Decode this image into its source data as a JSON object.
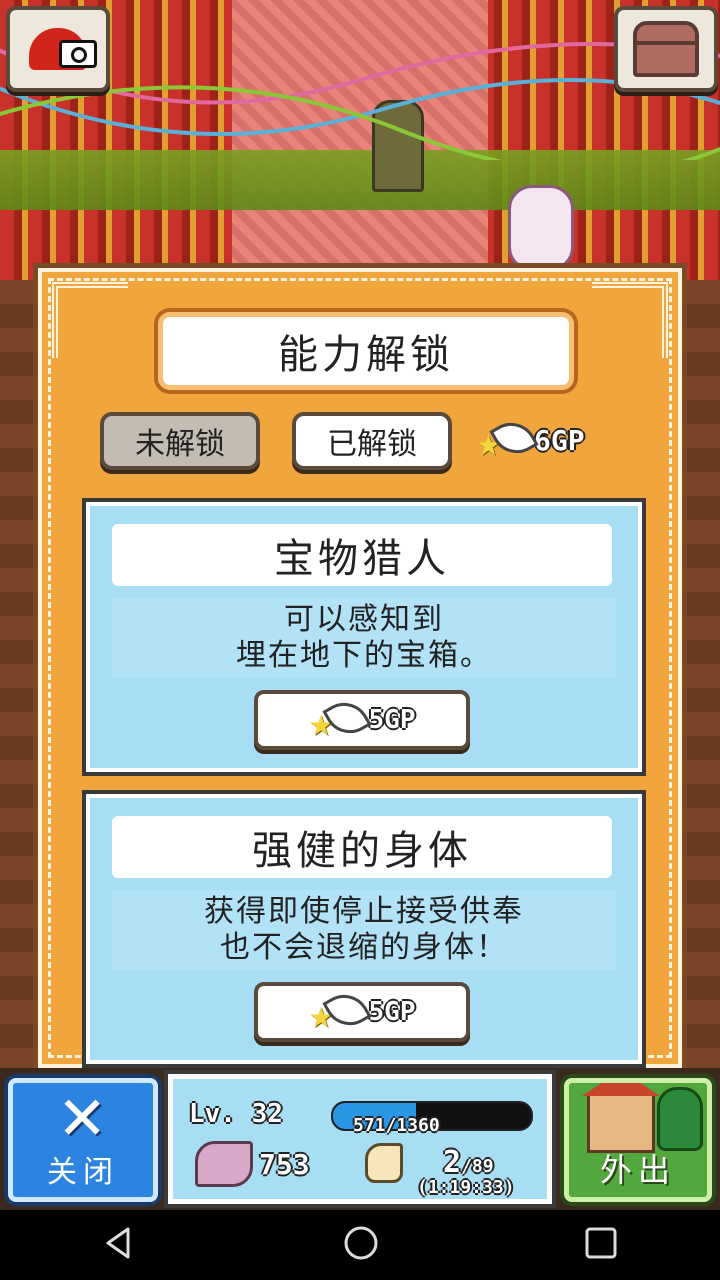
{
  "panel": {
    "title": "能力解锁",
    "tabs": {
      "locked": "未解锁",
      "unlocked": "已解锁"
    },
    "gp_total": "6GP"
  },
  "abilities": [
    {
      "title": "宝物猎人",
      "desc_line1": "可以感知到",
      "desc_line2": "埋在地下的宝箱。",
      "cost": "5GP"
    },
    {
      "title": "强健的身体",
      "desc_line1": "获得即使停止接受供奉",
      "desc_line2": "也不会退缩的身体！",
      "cost": "5GP"
    }
  ],
  "status": {
    "level": "Lv. 32",
    "xp_text": "571/1360",
    "xp_fraction": 0.42,
    "faith": "753",
    "followers_current": "2",
    "followers_max": "/89",
    "timer": "(1:19:33)"
  },
  "bottom": {
    "close_label": "关闭",
    "outing_label": "外出"
  },
  "colors": {
    "panel": "#f0a63c",
    "card": "#a8def4",
    "close": "#2c84e0",
    "outing": "#52a83c",
    "xp": "#2a96e6"
  },
  "icons": [
    "camera-icon",
    "chest-icon",
    "star-wing-icon",
    "close-x-icon",
    "praying-hand-icon",
    "arm-icon",
    "house-icon",
    "tree-icon",
    "back-nav-icon",
    "home-nav-icon",
    "recents-nav-icon"
  ]
}
